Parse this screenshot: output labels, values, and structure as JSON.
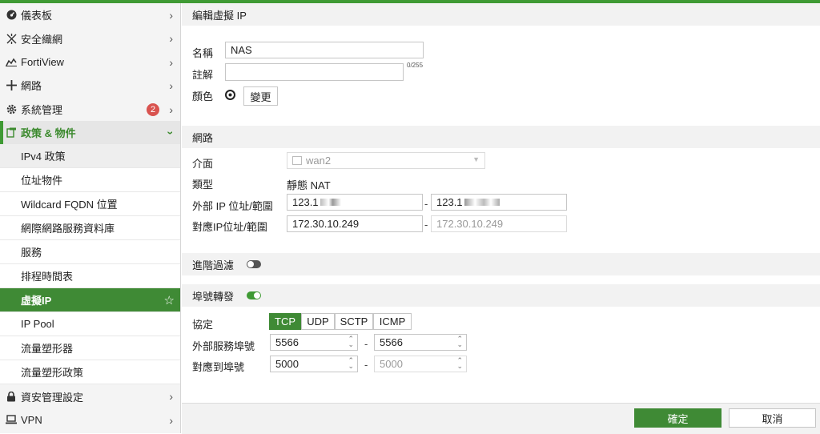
{
  "sidebar": {
    "items": [
      {
        "label": "儀表板",
        "icon": "dashboard-icon"
      },
      {
        "label": "安全織網",
        "icon": "fabric-icon"
      },
      {
        "label": "FortiView",
        "icon": "chart-icon"
      },
      {
        "label": "網路",
        "icon": "network-icon"
      },
      {
        "label": "系統管理",
        "icon": "gear-icon",
        "badge": "2"
      },
      {
        "label": "政策 & 物件",
        "icon": "policy-icon"
      }
    ],
    "sub_items": [
      "IPv4 政策",
      "位址物件",
      "Wildcard FQDN 位置",
      "網際網路服務資料庫",
      "服務",
      "排程時間表",
      "虛擬IP",
      "IP Pool",
      "流量塑形器",
      "流量塑形政策"
    ],
    "bottom_items": [
      {
        "label": "資安管理設定",
        "icon": "lock-icon"
      },
      {
        "label": "VPN",
        "icon": "laptop-icon"
      }
    ]
  },
  "form": {
    "title": "編輯虛擬 IP",
    "name_label": "名稱",
    "name_value": "NAS",
    "comment_label": "註解",
    "comment_value": "",
    "comment_counter": "0/255",
    "color_label": "顏色",
    "color_change_button": "變更",
    "network_section": "網路",
    "interface_label": "介面",
    "interface_value": "wan2",
    "type_label": "類型",
    "type_value": "靜態 NAT",
    "ext_ip_label": "外部 IP 位址/範圍",
    "ext_ip_start": "123.1",
    "ext_ip_end": "123.1",
    "mapped_ip_label": "對應IP位址/範圍",
    "mapped_ip_start": "172.30.10.249",
    "mapped_ip_end": "172.30.10.249",
    "range_dash": "-",
    "advanced_filter_label": "進階過濾",
    "port_forward_label": "埠號轉發",
    "protocol_label": "協定",
    "protocols": [
      "TCP",
      "UDP",
      "SCTP",
      "ICMP"
    ],
    "selected_protocol": "TCP",
    "ext_port_label": "外部服務埠號",
    "ext_port_start": "5566",
    "ext_port_end": "5566",
    "mapped_port_label": "對應到埠號",
    "mapped_port_start": "5000",
    "mapped_port_end": "5000"
  },
  "footer": {
    "ok_label": "確定",
    "cancel_label": "取消"
  },
  "colors": {
    "accent": "#3f9a34",
    "badge": "#d9534f"
  }
}
